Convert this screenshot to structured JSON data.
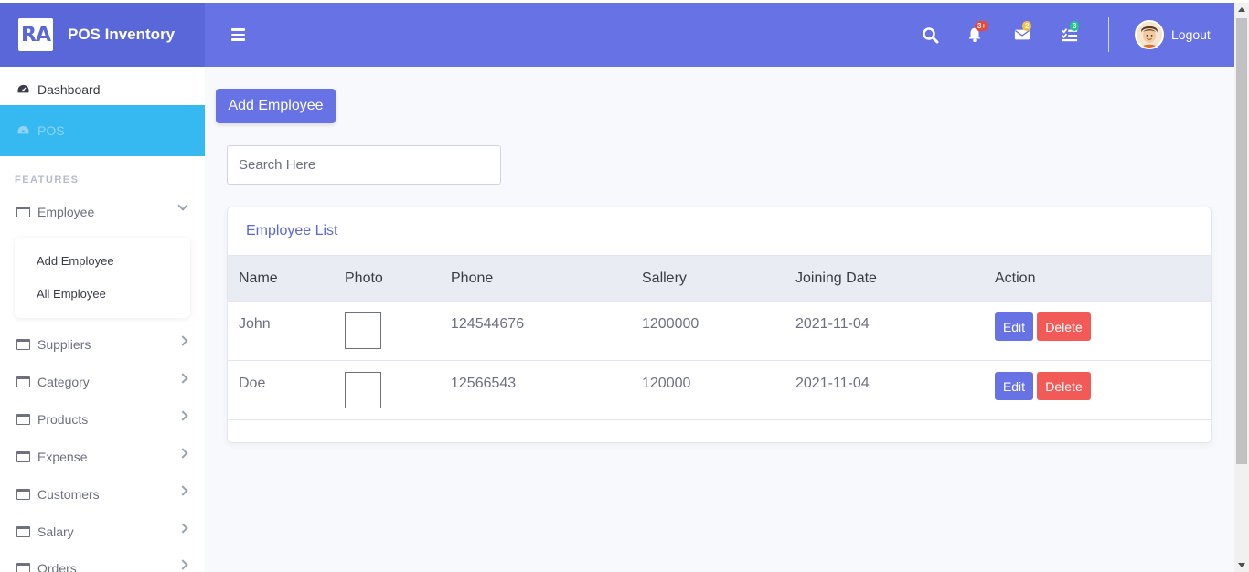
{
  "brand": {
    "logo_text": "RA",
    "name": "POS Inventory"
  },
  "sidebar": {
    "dashboard": "Dashboard",
    "pos": "POS",
    "section_heading": "FEATURES",
    "employee": {
      "label": "Employee",
      "sub_items": [
        "Add Employee",
        "All Employee"
      ]
    },
    "items": [
      "Suppliers",
      "Category",
      "Products",
      "Expense",
      "Customers",
      "Salary",
      "Orders"
    ]
  },
  "topbar": {
    "badges": {
      "alerts": "3+",
      "messages": "2",
      "tasks": "3"
    },
    "logout": "Logout",
    "icons": [
      "menu-icon",
      "search-icon",
      "bell-icon",
      "envelope-icon",
      "tasks-icon"
    ]
  },
  "main": {
    "add_button": "Add Employee",
    "search_placeholder": "Search Here",
    "card_title": "Employee List",
    "columns": [
      "Name",
      "Photo",
      "Phone",
      "Sallery",
      "Joining Date",
      "Action"
    ],
    "rows": [
      {
        "name": "John",
        "phone": "124544676",
        "salary": "1200000",
        "joining_date": "2021-11-04"
      },
      {
        "name": "Doe",
        "phone": "12566543",
        "salary": "120000",
        "joining_date": "2021-11-04"
      }
    ],
    "edit_label": "Edit",
    "delete_label": "Delete"
  },
  "colors": {
    "brand": "#5a67d8",
    "topbar": "#6772e5",
    "active_item": "#36b9f0",
    "delete": "#f25a57",
    "badge_alerts": "#e74a3b",
    "badge_messages": "#f6c23e",
    "badge_tasks": "#1cc88a"
  }
}
